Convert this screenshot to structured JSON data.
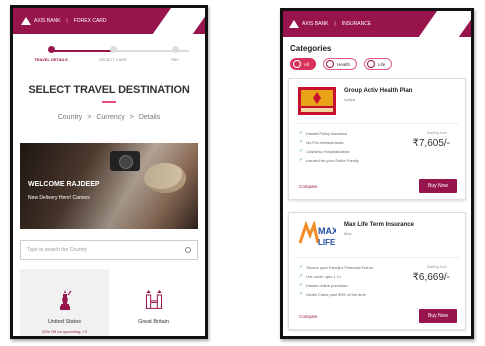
{
  "left": {
    "topbar": {
      "brand": "AXIS BANK",
      "section": "FOREX CARD"
    },
    "steps": [
      {
        "label": "TRAVEL DETAILS",
        "active": true
      },
      {
        "label": "SELECT CARD",
        "active": false
      },
      {
        "label": "PAY",
        "active": false
      }
    ],
    "title": "SELECT TRAVEL DESTINATION",
    "crumbs": [
      "Country",
      ">",
      "Currency",
      ">",
      "Details"
    ],
    "banner": {
      "welcome": "WELCOME RAJDEEP",
      "subtitle": "New Delivery Here! Cannes"
    },
    "search": {
      "placeholder": "Type to search the Country",
      "icon": "search-icon"
    },
    "countries": [
      {
        "name": "United States",
        "offer": "20% Off on upcoming..+2",
        "icon": "statue-of-liberty-icon",
        "selected": true
      },
      {
        "name": "Great Britain",
        "offer": "",
        "icon": "tower-bridge-icon",
        "selected": false
      }
    ]
  },
  "right": {
    "topbar": {
      "brand": "AXIS BANK",
      "section": "INSURANCE"
    },
    "categories_title": "Categories",
    "categories": [
      {
        "label": "All",
        "active": true
      },
      {
        "label": "Health",
        "active": false
      },
      {
        "label": "Life",
        "active": false
      }
    ],
    "products": [
      {
        "name": "Group Activ Health Plan",
        "provider": "Aditya",
        "features": [
          "Instant Policy Issuance",
          "No Pre-medical tests",
          "Cashless Hospitalization",
          "Insured for your Entire Family"
        ],
        "price_label": "Starting from",
        "price": "₹7,605/-",
        "compare": "Compare",
        "buy": "Buy Now",
        "logo": "aditya-birla-logo"
      },
      {
        "name": "Max Life Term Insurance",
        "provider": "Max",
        "features": [
          "Secure your Family's Financial Future",
          "Life cover upto 1 Cr",
          "Instant online purchase",
          "Death Claim paid 99% of the time"
        ],
        "price_label": "Starting from",
        "price": "₹6,669/-",
        "compare": "Compare",
        "buy": "Buy Now",
        "logo": "max-life-logo"
      }
    ]
  },
  "colors": {
    "brand": "#97144d",
    "accent": "#d8325f",
    "check": "#2e9e4f"
  }
}
